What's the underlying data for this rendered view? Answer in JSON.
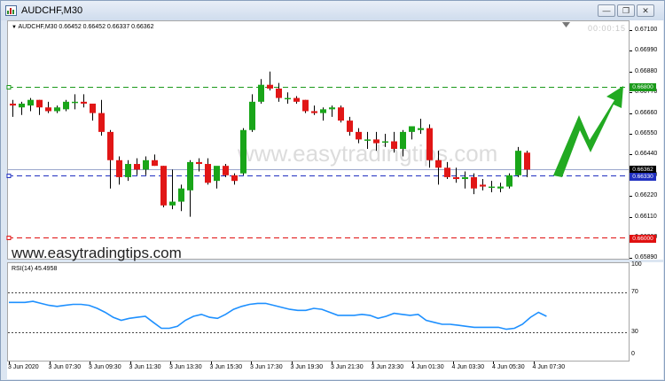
{
  "window": {
    "title": "AUDCHF,M30"
  },
  "chart": {
    "symbol_label": "AUDCHF,M30  0.66452 0.66452 0.66337 0.66362",
    "timer": "00:00:15",
    "watermark": "www.easytradingtips.com",
    "watermark_url": "www.easytradingtips.com",
    "rsi_label": "RSI(14) 45.4958",
    "colors": {
      "bull": "#19a519",
      "bear": "#e11616",
      "rsi": "#1e90ff",
      "arrow": "#22aa22"
    }
  },
  "price_scale": {
    "ticks": [
      "0.67100",
      "0.66990",
      "0.66880",
      "0.66770",
      "0.66660",
      "0.66550",
      "0.66440",
      "0.66330",
      "0.66220",
      "0.66110",
      "0.66000",
      "0.65890"
    ],
    "tags": [
      {
        "text": "0.66800",
        "color": "#1a9a1a"
      },
      {
        "text": "0.66362",
        "color": "#000000"
      },
      {
        "text": "0.66330",
        "color": "#2030c0"
      },
      {
        "text": "0.66000",
        "color": "#e01010"
      }
    ]
  },
  "rsi_scale": {
    "ticks": [
      "100",
      "70",
      "30",
      "0"
    ]
  },
  "time_scale": {
    "ticks": [
      "3 Jun 2020",
      "3 Jun 07:30",
      "3 Jun 09:30",
      "3 Jun 11:30",
      "3 Jun 13:30",
      "3 Jun 15:30",
      "3 Jun 17:30",
      "3 Jun 19:30",
      "3 Jun 21:30",
      "3 Jun 23:30",
      "4 Jun 01:30",
      "4 Jun 03:30",
      "4 Jun 05:30",
      "4 Jun 07:30"
    ]
  },
  "chart_data": {
    "type": "candlestick",
    "symbol": "AUDCHF",
    "timeframe": "M30",
    "ylim": [
      0.6585,
      0.6715
    ],
    "levels": [
      {
        "value": 0.668,
        "style": "dashed",
        "color": "#1a9a1a"
      },
      {
        "value": 0.6633,
        "style": "dashed",
        "color": "#2030c0"
      },
      {
        "value": 0.6636,
        "style": "solid",
        "color": "#9aa6cc"
      },
      {
        "value": 0.66,
        "style": "dashed",
        "color": "#e01010"
      }
    ],
    "candles": [
      {
        "o": 0.6671,
        "h": 0.6673,
        "l": 0.6664,
        "c": 0.667
      },
      {
        "o": 0.6669,
        "h": 0.6672,
        "l": 0.6665,
        "c": 0.6671
      },
      {
        "o": 0.667,
        "h": 0.6674,
        "l": 0.6667,
        "c": 0.6673
      },
      {
        "o": 0.6673,
        "h": 0.6673,
        "l": 0.6665,
        "c": 0.6669
      },
      {
        "o": 0.6669,
        "h": 0.6672,
        "l": 0.6666,
        "c": 0.6667
      },
      {
        "o": 0.6667,
        "h": 0.667,
        "l": 0.6666,
        "c": 0.6669
      },
      {
        "o": 0.6668,
        "h": 0.6673,
        "l": 0.6667,
        "c": 0.6672
      },
      {
        "o": 0.6672,
        "h": 0.6676,
        "l": 0.6668,
        "c": 0.6672
      },
      {
        "o": 0.6672,
        "h": 0.6676,
        "l": 0.6669,
        "c": 0.6671
      },
      {
        "o": 0.6671,
        "h": 0.6671,
        "l": 0.6662,
        "c": 0.6666
      },
      {
        "o": 0.6666,
        "h": 0.6673,
        "l": 0.6654,
        "c": 0.6656
      },
      {
        "o": 0.6656,
        "h": 0.6657,
        "l": 0.6626,
        "c": 0.6641
      },
      {
        "o": 0.6641,
        "h": 0.6643,
        "l": 0.6628,
        "c": 0.6632
      },
      {
        "o": 0.6632,
        "h": 0.6641,
        "l": 0.663,
        "c": 0.6639
      },
      {
        "o": 0.6639,
        "h": 0.6642,
        "l": 0.6633,
        "c": 0.6636
      },
      {
        "o": 0.6636,
        "h": 0.6643,
        "l": 0.6633,
        "c": 0.6641
      },
      {
        "o": 0.6641,
        "h": 0.6644,
        "l": 0.6638,
        "c": 0.6638
      },
      {
        "o": 0.6638,
        "h": 0.6638,
        "l": 0.6616,
        "c": 0.6617
      },
      {
        "o": 0.6617,
        "h": 0.6636,
        "l": 0.6615,
        "c": 0.6619
      },
      {
        "o": 0.6619,
        "h": 0.6628,
        "l": 0.6614,
        "c": 0.6626
      },
      {
        "o": 0.6625,
        "h": 0.6641,
        "l": 0.6611,
        "c": 0.664
      },
      {
        "o": 0.664,
        "h": 0.6642,
        "l": 0.6635,
        "c": 0.6639
      },
      {
        "o": 0.6639,
        "h": 0.6642,
        "l": 0.6628,
        "c": 0.6629
      },
      {
        "o": 0.663,
        "h": 0.6637,
        "l": 0.6626,
        "c": 0.6638
      },
      {
        "o": 0.6638,
        "h": 0.6639,
        "l": 0.6632,
        "c": 0.6633
      },
      {
        "o": 0.6633,
        "h": 0.6634,
        "l": 0.6628,
        "c": 0.663
      },
      {
        "o": 0.6634,
        "h": 0.6658,
        "l": 0.6633,
        "c": 0.6657
      },
      {
        "o": 0.6657,
        "h": 0.6676,
        "l": 0.6656,
        "c": 0.6672
      },
      {
        "o": 0.6672,
        "h": 0.6684,
        "l": 0.6671,
        "c": 0.6681
      },
      {
        "o": 0.6681,
        "h": 0.6688,
        "l": 0.6678,
        "c": 0.6679
      },
      {
        "o": 0.6679,
        "h": 0.6682,
        "l": 0.6672,
        "c": 0.6674
      },
      {
        "o": 0.6674,
        "h": 0.6677,
        "l": 0.6671,
        "c": 0.6674
      },
      {
        "o": 0.6674,
        "h": 0.6675,
        "l": 0.6671,
        "c": 0.6672
      },
      {
        "o": 0.6673,
        "h": 0.6673,
        "l": 0.6666,
        "c": 0.6667
      },
      {
        "o": 0.6667,
        "h": 0.667,
        "l": 0.6665,
        "c": 0.6666
      },
      {
        "o": 0.6666,
        "h": 0.6669,
        "l": 0.6662,
        "c": 0.6668
      },
      {
        "o": 0.6668,
        "h": 0.667,
        "l": 0.6664,
        "c": 0.6669
      },
      {
        "o": 0.6669,
        "h": 0.667,
        "l": 0.6661,
        "c": 0.6662
      },
      {
        "o": 0.6662,
        "h": 0.6664,
        "l": 0.6654,
        "c": 0.6656
      },
      {
        "o": 0.6656,
        "h": 0.6658,
        "l": 0.665,
        "c": 0.6652
      },
      {
        "o": 0.6652,
        "h": 0.6656,
        "l": 0.6647,
        "c": 0.6652
      },
      {
        "o": 0.6652,
        "h": 0.6656,
        "l": 0.6646,
        "c": 0.665
      },
      {
        "o": 0.6651,
        "h": 0.6655,
        "l": 0.6648,
        "c": 0.6651
      },
      {
        "o": 0.6651,
        "h": 0.6656,
        "l": 0.6645,
        "c": 0.6647
      },
      {
        "o": 0.6647,
        "h": 0.6657,
        "l": 0.6643,
        "c": 0.6656
      },
      {
        "o": 0.6656,
        "h": 0.6659,
        "l": 0.6652,
        "c": 0.6659
      },
      {
        "o": 0.6657,
        "h": 0.6663,
        "l": 0.6655,
        "c": 0.6658
      },
      {
        "o": 0.6658,
        "h": 0.666,
        "l": 0.6637,
        "c": 0.6641
      },
      {
        "o": 0.6641,
        "h": 0.6646,
        "l": 0.6628,
        "c": 0.6637
      },
      {
        "o": 0.6637,
        "h": 0.664,
        "l": 0.6631,
        "c": 0.6632
      },
      {
        "o": 0.6632,
        "h": 0.6637,
        "l": 0.6629,
        "c": 0.6631
      },
      {
        "o": 0.6631,
        "h": 0.6635,
        "l": 0.6626,
        "c": 0.6632
      },
      {
        "o": 0.6632,
        "h": 0.6634,
        "l": 0.6623,
        "c": 0.6626
      },
      {
        "o": 0.6628,
        "h": 0.6631,
        "l": 0.6625,
        "c": 0.6627
      },
      {
        "o": 0.6627,
        "h": 0.663,
        "l": 0.6624,
        "c": 0.6627
      },
      {
        "o": 0.6626,
        "h": 0.6629,
        "l": 0.6624,
        "c": 0.6627
      },
      {
        "o": 0.6627,
        "h": 0.6634,
        "l": 0.6626,
        "c": 0.6633
      },
      {
        "o": 0.6633,
        "h": 0.6648,
        "l": 0.6632,
        "c": 0.6646
      },
      {
        "o": 0.6645,
        "h": 0.6646,
        "l": 0.6632,
        "c": 0.6636
      }
    ],
    "rsi": {
      "name": "RSI(14) 45.4958",
      "ylim": [
        0,
        100
      ],
      "levels": [
        70,
        30
      ],
      "values": [
        60,
        60,
        60,
        61,
        59,
        57,
        56,
        57,
        58,
        58,
        57,
        54,
        50,
        45,
        42,
        44,
        45,
        46,
        40,
        34,
        34,
        36,
        42,
        46,
        48,
        45,
        44,
        48,
        53,
        56,
        58,
        59,
        59,
        57,
        55,
        53,
        52,
        52,
        54,
        53,
        50,
        47,
        47,
        47,
        48,
        47,
        44,
        46,
        49,
        48,
        47,
        48,
        42,
        40,
        38,
        38,
        37,
        36,
        35,
        35,
        35,
        35,
        33,
        34,
        38,
        45,
        50,
        46
      ]
    }
  }
}
